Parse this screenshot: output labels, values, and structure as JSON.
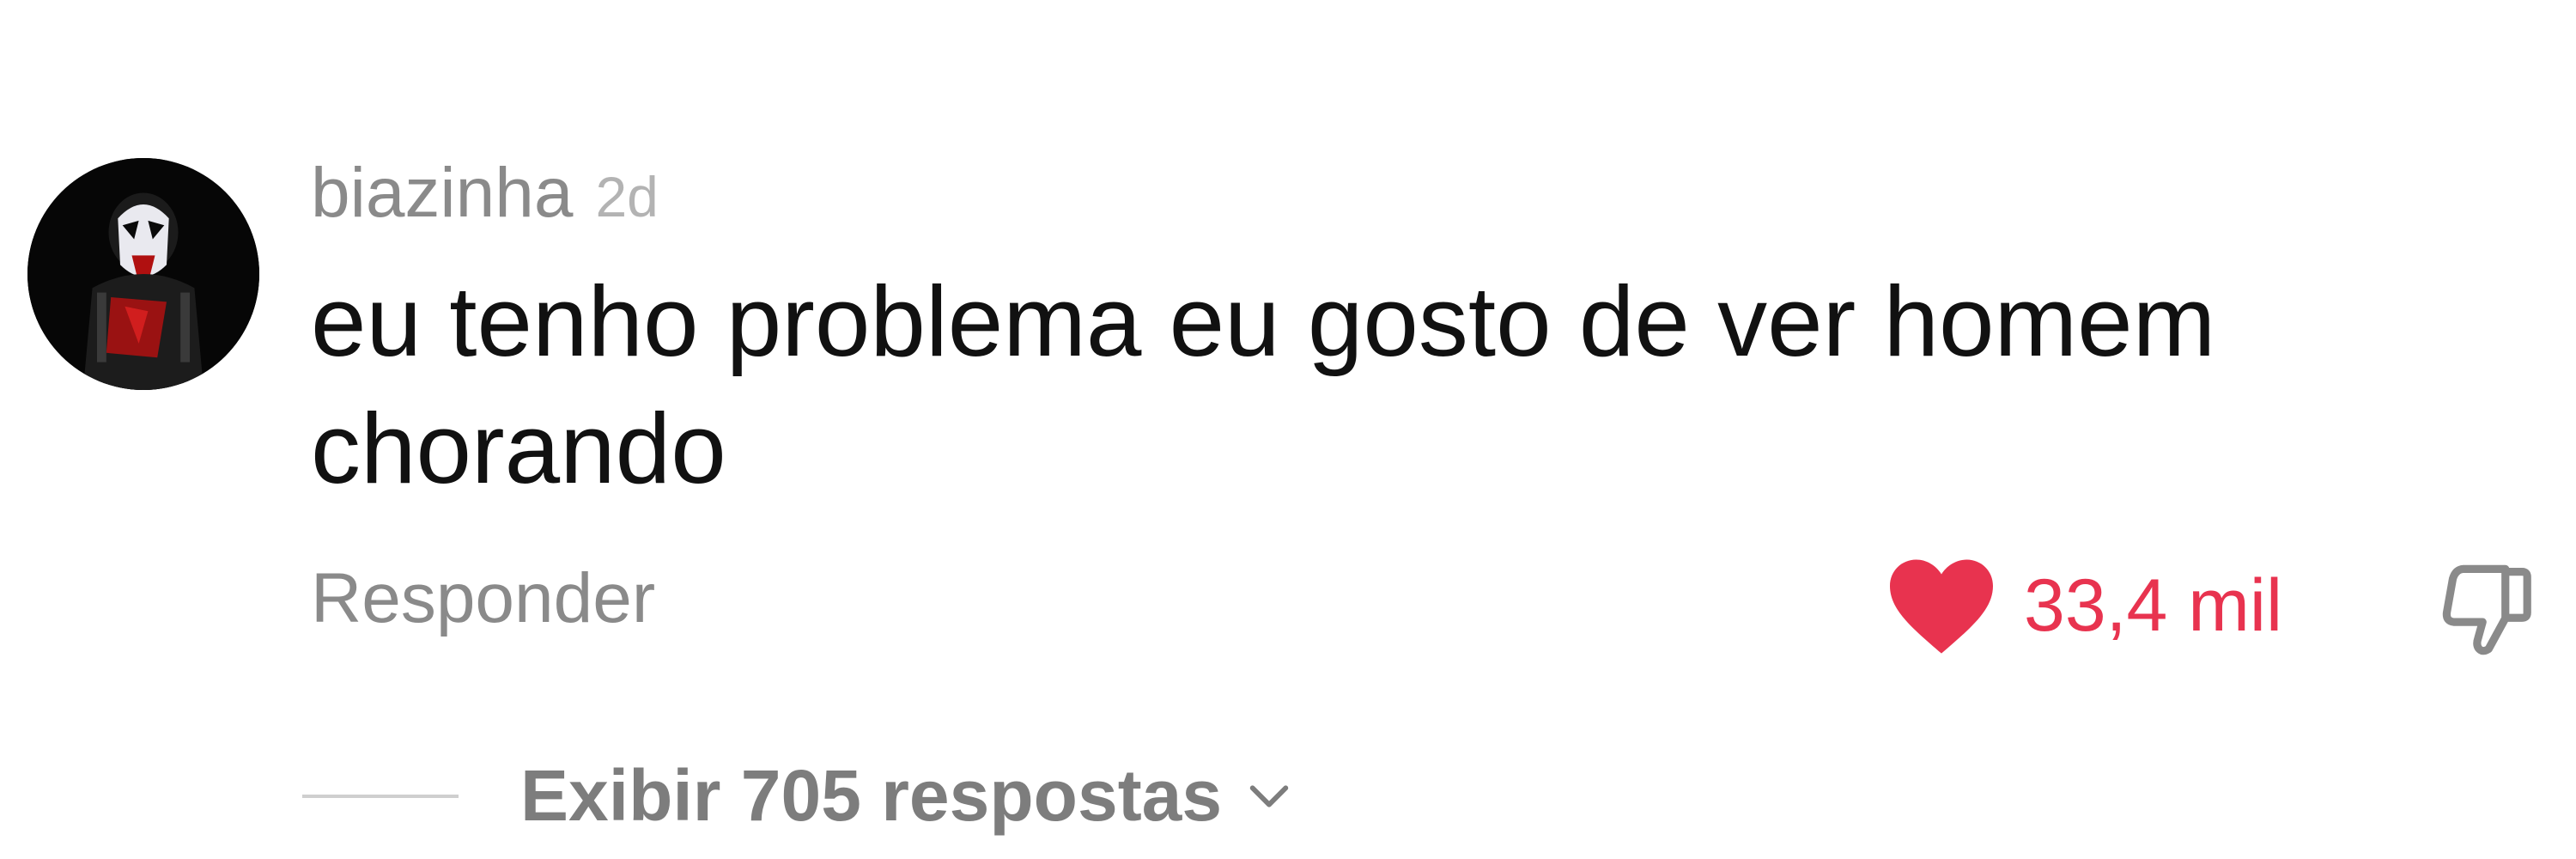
{
  "comment": {
    "username": "biazinha",
    "time": "2d",
    "text": "eu tenho problema eu gosto de ver homem chorando",
    "reply_label": "Responder",
    "like_count": "33,4 mil",
    "liked": true,
    "view_replies_label": "Exibir 705 respostas"
  },
  "icons": {
    "avatar": "user-avatar-image",
    "like": "heart-icon",
    "dislike": "thumbs-down-icon",
    "expand": "chevron-down-icon"
  },
  "colors": {
    "like": "#e8334f",
    "username": "#8a8a8a",
    "text": "#111111",
    "secondary": "#7d7d7d"
  }
}
